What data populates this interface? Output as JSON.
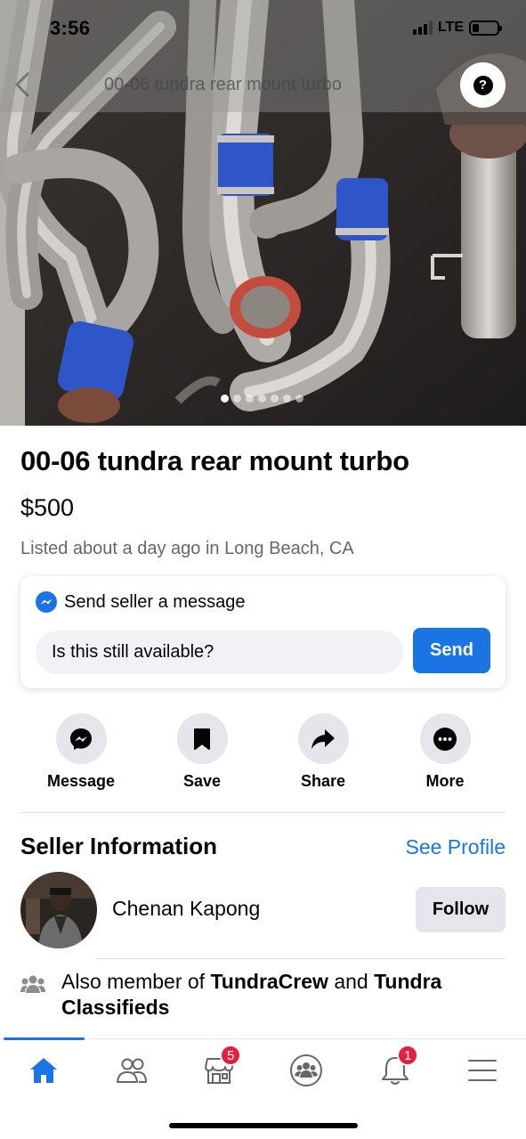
{
  "status_bar": {
    "time": "3:56",
    "network": "LTE"
  },
  "header": {
    "title": "00-06 tundra rear mount turbo"
  },
  "gallery": {
    "photo_count": 7,
    "active_index": 0
  },
  "listing": {
    "title": "00-06 tundra rear mount turbo",
    "price": "$500",
    "meta": "Listed about a day ago in Long Beach, CA"
  },
  "message_card": {
    "heading": "Send seller a message",
    "input_value": "Is this still available?",
    "send_label": "Send"
  },
  "actions": [
    {
      "label": "Message",
      "icon": "messenger-icon"
    },
    {
      "label": "Save",
      "icon": "bookmark-icon"
    },
    {
      "label": "Share",
      "icon": "share-arrow-icon"
    },
    {
      "label": "More",
      "icon": "more-dots-icon"
    }
  ],
  "seller": {
    "heading": "Seller Information",
    "see_profile": "See Profile",
    "name": "Chenan Kapong",
    "follow_label": "Follow",
    "membership_prefix": "Also member of",
    "group_1": "TundraCrew",
    "conjunction": "and",
    "group_2": "Tundra Classifieds"
  },
  "tabbar": {
    "active": "home",
    "items": [
      {
        "name": "home",
        "icon": "home-icon"
      },
      {
        "name": "friends",
        "icon": "friends-icon"
      },
      {
        "name": "marketplace",
        "icon": "marketplace-icon",
        "badge": "5"
      },
      {
        "name": "groups",
        "icon": "groups-icon"
      },
      {
        "name": "notifications",
        "icon": "bell-icon",
        "badge": "1"
      },
      {
        "name": "menu",
        "icon": "menu-icon"
      }
    ]
  },
  "colors": {
    "accent": "#1b74e4",
    "badge": "#e41e3f",
    "button_gray": "#e4e6eb",
    "secondary_text": "#65676b",
    "pipe_coupler": "#2f56c9"
  }
}
